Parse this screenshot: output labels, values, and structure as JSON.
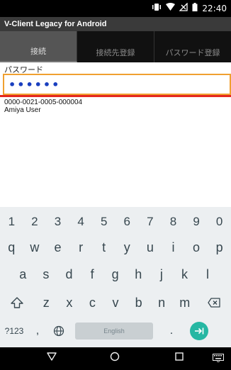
{
  "status_bar": {
    "time": "22:40",
    "icons": [
      "vibrate-icon",
      "wifi-icon",
      "signal-icon",
      "battery-icon"
    ]
  },
  "app": {
    "title": "V-Client Legacy for Android"
  },
  "tabs": [
    {
      "label": "接続",
      "active": true
    },
    {
      "label": "接続先登録",
      "active": false
    },
    {
      "label": "パスワード登録",
      "active": false
    }
  ],
  "form": {
    "password_label": "パスワード",
    "password_value": "••••••"
  },
  "info": {
    "device_id": "0000-0021-0005-000004",
    "user": "Amiya User"
  },
  "keyboard": {
    "row1": [
      "1",
      "2",
      "3",
      "4",
      "5",
      "6",
      "7",
      "8",
      "9",
      "0"
    ],
    "row2": [
      "q",
      "w",
      "e",
      "r",
      "t",
      "y",
      "u",
      "i",
      "o",
      "p"
    ],
    "row3": [
      "a",
      "s",
      "d",
      "f",
      "g",
      "h",
      "j",
      "k",
      "l"
    ],
    "row4": [
      "z",
      "x",
      "c",
      "v",
      "b",
      "n",
      "m"
    ],
    "symbols_label": "?123",
    "comma": ",",
    "space_label": "English",
    "period": ".",
    "colors": {
      "enter": "#26b7a3",
      "background": "#eceff1"
    }
  },
  "colors": {
    "input_border": "#f0a030",
    "underline": "#e4281e"
  }
}
